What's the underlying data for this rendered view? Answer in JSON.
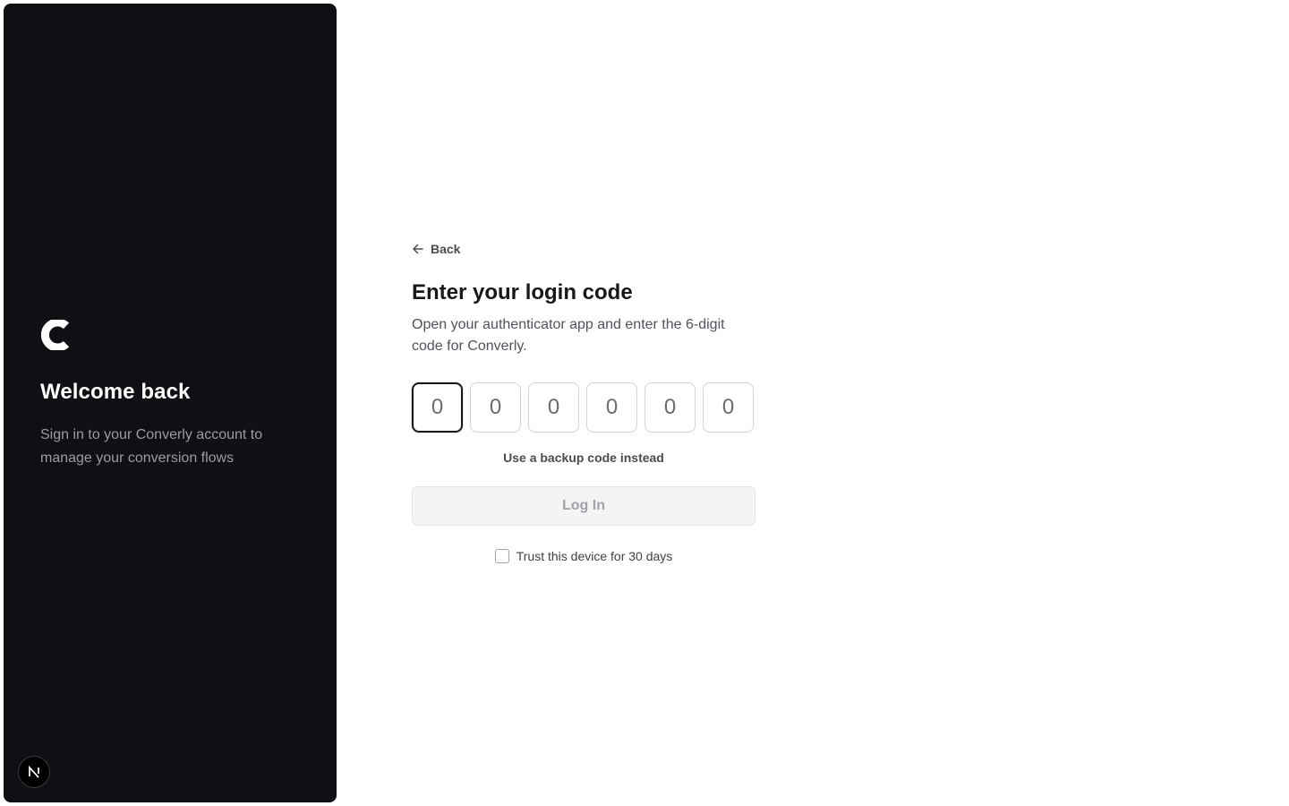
{
  "sidebar": {
    "logo_icon": "converly-logo-icon",
    "title": "Welcome back",
    "subtitle": "Sign in to your Converly account to manage your conversion flows",
    "badge_label": "N",
    "background_color": "#0f1013"
  },
  "form": {
    "back_label": "Back",
    "title": "Enter your login code",
    "subtitle": "Open your authenticator app and enter the 6-digit code for Converly.",
    "code_placeholders": [
      "0",
      "0",
      "0",
      "0",
      "0",
      "0"
    ],
    "backup_link": "Use a backup code instead",
    "login_button": "Log In",
    "trust_label": "Trust this device for 30 days",
    "trust_checked": false
  }
}
